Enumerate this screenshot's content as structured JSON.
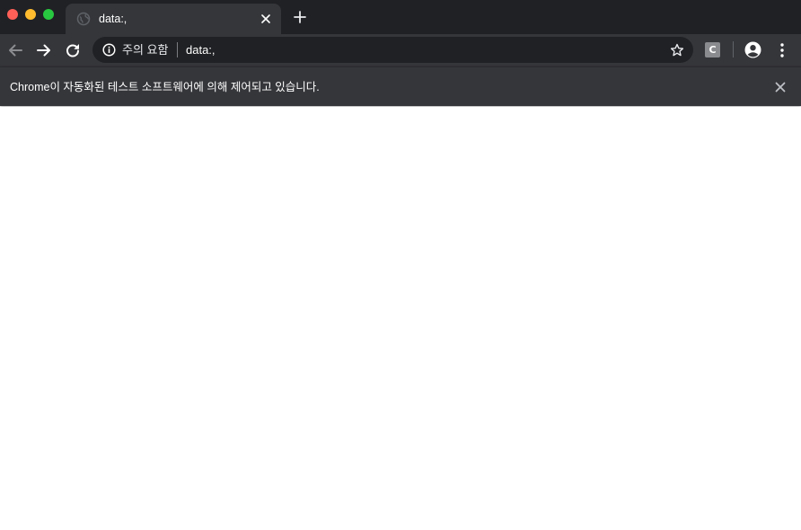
{
  "window": {
    "traffic_lights": [
      "close",
      "minimize",
      "maximize"
    ]
  },
  "tabs": [
    {
      "title": "data:,",
      "favicon": "globe-icon",
      "active": true
    }
  ],
  "toolbar": {
    "security_label": "주의 요함",
    "url": "data:,",
    "extension_label": "C"
  },
  "infobar": {
    "message": "Chrome이 자동화된 테스트 소프트웨어에 의해 제어되고 있습니다."
  },
  "colors": {
    "tabstrip": "#202124",
    "toolbar": "#35363a",
    "omnibox": "#202124",
    "content": "#ffffff"
  }
}
